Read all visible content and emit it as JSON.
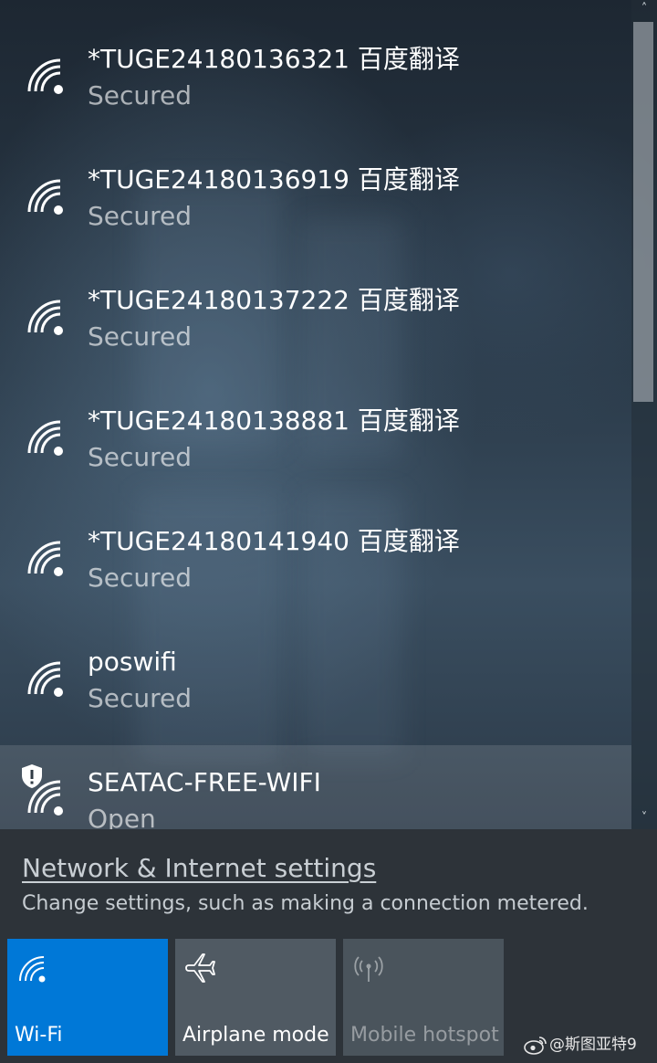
{
  "networks": [
    {
      "name": "*TUGE24180136321 百度翻译",
      "status": "Secured",
      "icon": "wifi-signal-icon"
    },
    {
      "name": "*TUGE24180136919 百度翻译",
      "status": "Secured",
      "icon": "wifi-signal-icon"
    },
    {
      "name": "*TUGE24180137222 百度翻译",
      "status": "Secured",
      "icon": "wifi-signal-icon"
    },
    {
      "name": "*TUGE24180138881 百度翻译",
      "status": "Secured",
      "icon": "wifi-signal-icon"
    },
    {
      "name": "*TUGE24180141940 百度翻译",
      "status": "Secured",
      "icon": "wifi-signal-icon"
    },
    {
      "name": "poswifi",
      "status": "Secured",
      "icon": "wifi-signal-icon"
    },
    {
      "name": "SEATAC-FREE-WIFI",
      "status": "Open",
      "icon": "wifi-signal-icon",
      "warning_icon": "shield-warning-icon"
    }
  ],
  "scrollbar": {
    "up_icon": "chevron-up-icon",
    "down_icon": "chevron-down-icon"
  },
  "settings": {
    "link": "Network & Internet settings",
    "description": "Change settings, such as making a connection metered."
  },
  "quick_actions": [
    {
      "label": "Wi-Fi",
      "icon": "wifi-icon",
      "state": "on"
    },
    {
      "label": "Airplane mode",
      "icon": "airplane-icon",
      "state": "off"
    },
    {
      "label": "Mobile hotspot",
      "icon": "hotspot-icon",
      "state": "disabled"
    }
  ],
  "watermark": {
    "text": "@斯图亚特9",
    "icon": "weibo-icon"
  },
  "colors": {
    "accent": "#0078d7",
    "tile_off": "#505a63",
    "panel": "#2d3339"
  }
}
